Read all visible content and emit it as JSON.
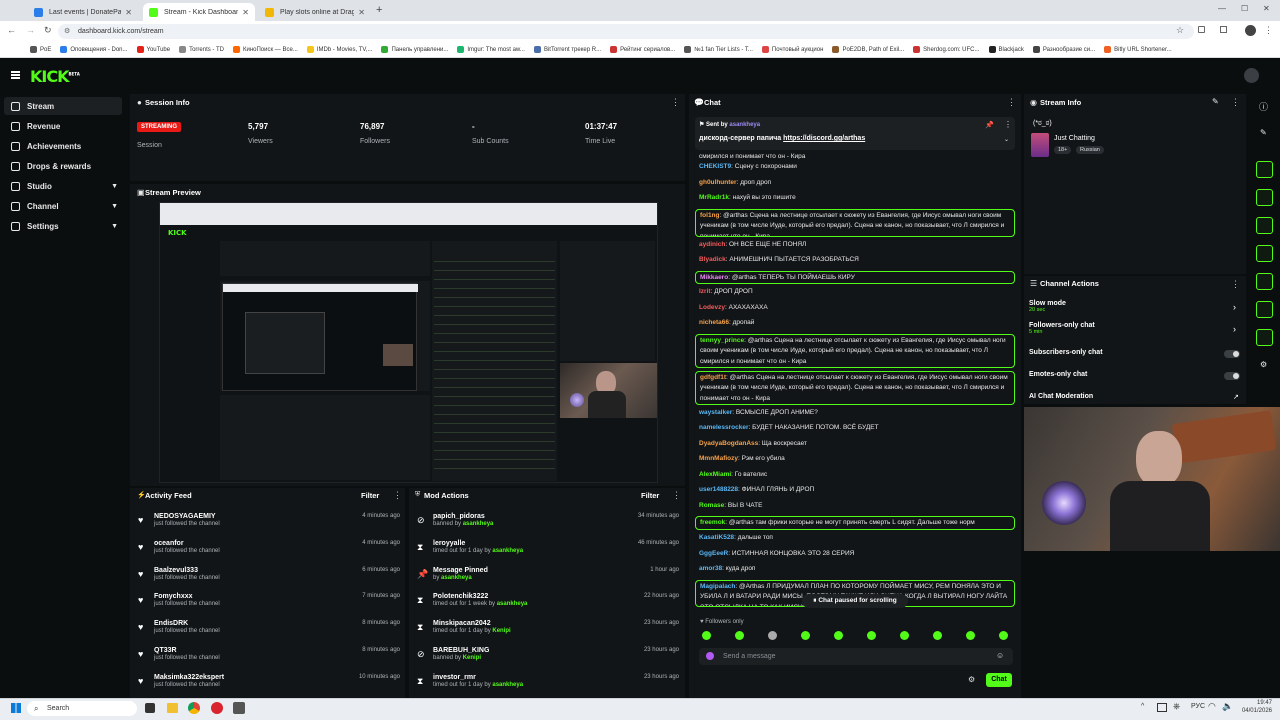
{
  "browser": {
    "tabs": [
      {
        "label": "Last events | DonatePay",
        "icon_color": "#2b7de9",
        "active": false
      },
      {
        "label": "Stream - Kick Dashboard",
        "icon_color": "#53fc18",
        "active": true
      },
      {
        "label": "Play slots online at Dragon Mo",
        "icon_color": "#f2b705",
        "active": false
      }
    ],
    "url": "dashboard.kick.com/stream",
    "bookmarks": [
      {
        "label": "PoE",
        "icon_color": "#555"
      },
      {
        "label": "Оповещения - Don...",
        "icon_color": "#2b7de9"
      },
      {
        "label": "YouTube",
        "icon_color": "#e62117"
      },
      {
        "label": "Torrents - TD",
        "icon_color": "#888"
      },
      {
        "label": "КиноПоиск — Все...",
        "icon_color": "#f60"
      },
      {
        "label": "IMDb - Movies, TV,...",
        "icon_color": "#f5c518"
      },
      {
        "label": "Панель управлени...",
        "icon_color": "#3a3"
      },
      {
        "label": "Imgur: The most aw...",
        "icon_color": "#1bb76e"
      },
      {
        "label": "BitTorrent трекер R...",
        "icon_color": "#4a6ea9"
      },
      {
        "label": "Рейтинг сериалов...",
        "icon_color": "#c33"
      },
      {
        "label": "№1 fan Tier Lists - T...",
        "icon_color": "#555"
      },
      {
        "label": "Почтовый аукцион",
        "icon_color": "#d44"
      },
      {
        "label": "PoE2DB, Path of Exil...",
        "icon_color": "#8a5a2b"
      },
      {
        "label": "Sherdog.com: UFC...",
        "icon_color": "#c33"
      },
      {
        "label": "Blackjack",
        "icon_color": "#222"
      },
      {
        "label": "Разнообразие си...",
        "icon_color": "#444"
      },
      {
        "label": "Bitly URL Shortener...",
        "icon_color": "#ee6123"
      }
    ]
  },
  "app": {
    "logo": "KICK",
    "logo_sup": "BETA"
  },
  "sidebar": {
    "items": [
      {
        "label": "Stream",
        "icon": "broadcast-icon",
        "expandable": false,
        "active": true
      },
      {
        "label": "Revenue",
        "icon": "revenue-icon",
        "expandable": false,
        "active": false
      },
      {
        "label": "Achievements",
        "icon": "trophy-icon",
        "expandable": false,
        "active": false
      },
      {
        "label": "Drops & rewards",
        "icon": "gift-icon",
        "expandable": false,
        "active": false
      },
      {
        "label": "Studio",
        "icon": "studio-icon",
        "expandable": true,
        "active": false
      },
      {
        "label": "Channel",
        "icon": "channel-icon",
        "expandable": true,
        "active": false
      },
      {
        "label": "Settings",
        "icon": "gear-icon",
        "expandable": true,
        "active": false
      }
    ]
  },
  "session": {
    "title": "Session Info",
    "status": "STREAMING",
    "status_label": "Session",
    "stats": [
      {
        "value": "5,797",
        "label": "Viewers"
      },
      {
        "value": "76,897",
        "label": "Followers"
      },
      {
        "value": "-",
        "label": "Sub Counts"
      },
      {
        "value": "01:37:47",
        "label": "Time Live"
      }
    ]
  },
  "preview": {
    "title": "Stream Preview"
  },
  "activity": {
    "title": "Activity Feed",
    "filter": "Filter",
    "items": [
      {
        "name": "NEDOSYAGAEMIY",
        "action": "just followed the channel",
        "time": "4 minutes ago"
      },
      {
        "name": "oceanfor",
        "action": "just followed the channel",
        "time": "4 minutes ago"
      },
      {
        "name": "Baalzevul333",
        "action": "just followed the channel",
        "time": "6 minutes ago"
      },
      {
        "name": "Fomychxxx",
        "action": "just followed the channel",
        "time": "7 minutes ago"
      },
      {
        "name": "EndisDRK",
        "action": "just followed the channel",
        "time": "8 minutes ago"
      },
      {
        "name": "QT33R",
        "action": "just followed the channel",
        "time": "8 minutes ago"
      },
      {
        "name": "Maksimka322ekspert",
        "action": "just followed the channel",
        "time": "10 minutes ago"
      }
    ]
  },
  "mod": {
    "title": "Mod Actions",
    "filter": "Filter",
    "items": [
      {
        "name": "papich_pidoras",
        "action": "banned by",
        "by": "asankheya",
        "time": "34 minutes ago",
        "icon": "ban-icon"
      },
      {
        "name": "leroyyalle",
        "action": "timed out for 1 day by",
        "by": "asankheya",
        "time": "46 minutes ago",
        "icon": "hourglass-icon"
      },
      {
        "name": "Message Pinned",
        "action": "by",
        "by": "asankheya",
        "time": "1 hour ago",
        "icon": "pin-icon"
      },
      {
        "name": "Polotenchik3222",
        "action": "timed out for 1 week by",
        "by": "asankheya",
        "time": "22 hours ago",
        "icon": "hourglass-icon"
      },
      {
        "name": "Minskipacan2042",
        "action": "timed out for 1 day by",
        "by": "Kenipi",
        "time": "23 hours ago",
        "icon": "hourglass-icon"
      },
      {
        "name": "BAREBUH_KING",
        "action": "banned by",
        "by": "Kenipi",
        "time": "23 hours ago",
        "icon": "ban-icon"
      },
      {
        "name": "investor_rmr",
        "action": "timed out for 1 day by",
        "by": "asankheya",
        "time": "23 hours ago",
        "icon": "hourglass-icon"
      }
    ]
  },
  "chat": {
    "title": "Chat",
    "pinned": {
      "prefix": "Sent by",
      "user": "asankheya",
      "text": "дискорд-сервер папича",
      "link": "https://discord.gg/arthas"
    },
    "paused": "Chat paused for scrolling",
    "followers_only": "Followers only",
    "placeholder": "Send a message",
    "send": "Chat",
    "messages": [
      {
        "user": "",
        "color": "#e8e8e8",
        "text": "смирился и понимает что он - Кира",
        "hl": false
      },
      {
        "user": "CHEKIST9",
        "color": "#5ab8f7",
        "text": "Сцену с похоронами",
        "hl": false
      },
      {
        "user": "gh0ulhunter",
        "color": "#f7a24a",
        "text": "дроп дроп",
        "hl": false
      },
      {
        "user": "MrRadr1k",
        "color": "#53fc18",
        "text": "нахуй вы это пишите",
        "hl": false
      },
      {
        "user": "fol1ng",
        "color": "#f7a24a",
        "text": "@arthas Сцена на лестнице отсылает к сюжету из Евангелия, где Иисус омывал ноги своим ученикам (в том числе Иуде, который его предал). Сцена не канон, но показывает, что Л смирился и понимает что он - Кира",
        "hl": true
      },
      {
        "user": "aydinich",
        "color": "#f45d5d",
        "text": "ОН ВСЕ ЕЩЕ НЕ ПОНЯЛ",
        "hl": false
      },
      {
        "user": "Blyadick",
        "color": "#f45d5d",
        "text": "АНИМЕШНИЧ ПЫТАЕТСЯ РАЗОБРАТЬСЯ",
        "hl": false
      },
      {
        "user": "Mikkaero",
        "color": "#e98df2",
        "text": "@arthas ТЕПЕРЬ ТЫ ПОЙМАЕШЬ КИРУ",
        "hl": true
      },
      {
        "user": "Izrit",
        "color": "#f45d5d",
        "text": "ДРОП ДРОП",
        "hl": false
      },
      {
        "user": "Lodevzy",
        "color": "#f45d5d",
        "text": "АХАХАХАХА",
        "hl": false
      },
      {
        "user": "nicheta66",
        "color": "#f7a24a",
        "text": "дропай",
        "hl": false
      },
      {
        "user": "tennyy_prince",
        "color": "#53fc18",
        "text": "@arthas Сцена на лестнице отсылает к сюжету из Евангелия, где Иисус омывал ноги своим ученикам (в том числе Иуде, который его предал). Сцена не канон, но показывает, что Л смирился и понимает что он - Кира",
        "hl": true
      },
      {
        "user": "gdfgdf1t",
        "color": "#f7a24a",
        "text": "@arthas Сцена на лестнице отсылает к сюжету из Евангелия, где Иисус омывал ноги своим ученикам (в том числе Иуде, который его предал). Сцена не канон, но показывает, что Л смирился и понимает что он - Кира",
        "hl": true
      },
      {
        "user": "waystalker",
        "color": "#5ab8f7",
        "text": "ВСМЫСЛЕ ДРОП АНИМЕ?",
        "hl": false
      },
      {
        "user": "namelessrocker",
        "color": "#5ab8f7",
        "text": "БУДЕТ НАКАЗАНИЕ ПОТОМ. ВСЁ БУДЕТ",
        "hl": false
      },
      {
        "user": "DyadyaBogdanAss",
        "color": "#f7a24a",
        "text": "Ща воскресает",
        "hl": false
      },
      {
        "user": "MmnMafiozy",
        "color": "#f7a24a",
        "text": "Рэм его убила",
        "hl": false
      },
      {
        "user": "AlexMiami",
        "color": "#53fc18",
        "text": "Го вателис",
        "hl": false
      },
      {
        "user": "user1488228",
        "color": "#5ab8f7",
        "text": "ФИНАЛ ГЛЯНЬ И ДРОП",
        "hl": false
      },
      {
        "user": "Romase",
        "color": "#53fc18",
        "text": "ВЫ В ЧАТЕ",
        "hl": false
      },
      {
        "user": "freemok",
        "color": "#53fc18",
        "text": "@arthas там фрики которые не могут принять смерть L сидят. Дальше тоже норм",
        "hl": true
      },
      {
        "user": "KasatiK528",
        "color": "#5ab8f7",
        "text": "дальше топ",
        "hl": false
      },
      {
        "user": "GggEeeR",
        "color": "#5ab8f7",
        "text": "ИСТИННАЯ КОНЦОВКА ЭТО 28 СЕРИЯ",
        "hl": false
      },
      {
        "user": "amor38",
        "color": "#5ab8f7",
        "text": "куда дроп",
        "hl": false
      },
      {
        "user": "Magipalach",
        "color": "#5ab8f7",
        "text": "@Arthas Л ПРИДУМАЛ ПЛАН ПО КОТОРОМУ ПОЙМАЕТ МИСУ, РЕМ ПОНЯЛА ЭТО И УБИЛА Л И ВАТАРИ РАДИ МИСЫ. ПОЭТОМУ ТАКЖЕ ИЛИ СЦЕНА КОГДА Л ВЫТИРАЛ НОГУ ЛАЙТА ЭТО ОТСЫЛКА НА ТО КАК ИИСУС ОБМЫЛ НОГИ ИУДЕ",
        "hl": true
      }
    ]
  },
  "stream_info": {
    "title": "Stream Info",
    "stream_title": "(*ಠ_ಠ)",
    "category": "Just Chatting",
    "tags": [
      "18+",
      "Russian"
    ]
  },
  "channel_actions": {
    "title": "Channel Actions",
    "items": [
      {
        "label": "Slow mode",
        "sub": "20 sec",
        "control": "arrow"
      },
      {
        "label": "Followers-only chat",
        "sub": "5 min",
        "control": "arrow"
      },
      {
        "label": "Subscribers-only chat",
        "sub": "",
        "control": "toggle"
      },
      {
        "label": "Emotes-only chat",
        "sub": "",
        "control": "toggle"
      },
      {
        "label": "AI Chat Moderation",
        "sub": "",
        "control": "link"
      }
    ]
  },
  "taskbar": {
    "search": "Search",
    "lang": "РУС",
    "time": "19:47",
    "date": "04/01/2026"
  },
  "colors": {
    "accent": "#53fc18",
    "live": "#e91916",
    "bg": "#0b0e0f",
    "panel": "#121517"
  }
}
